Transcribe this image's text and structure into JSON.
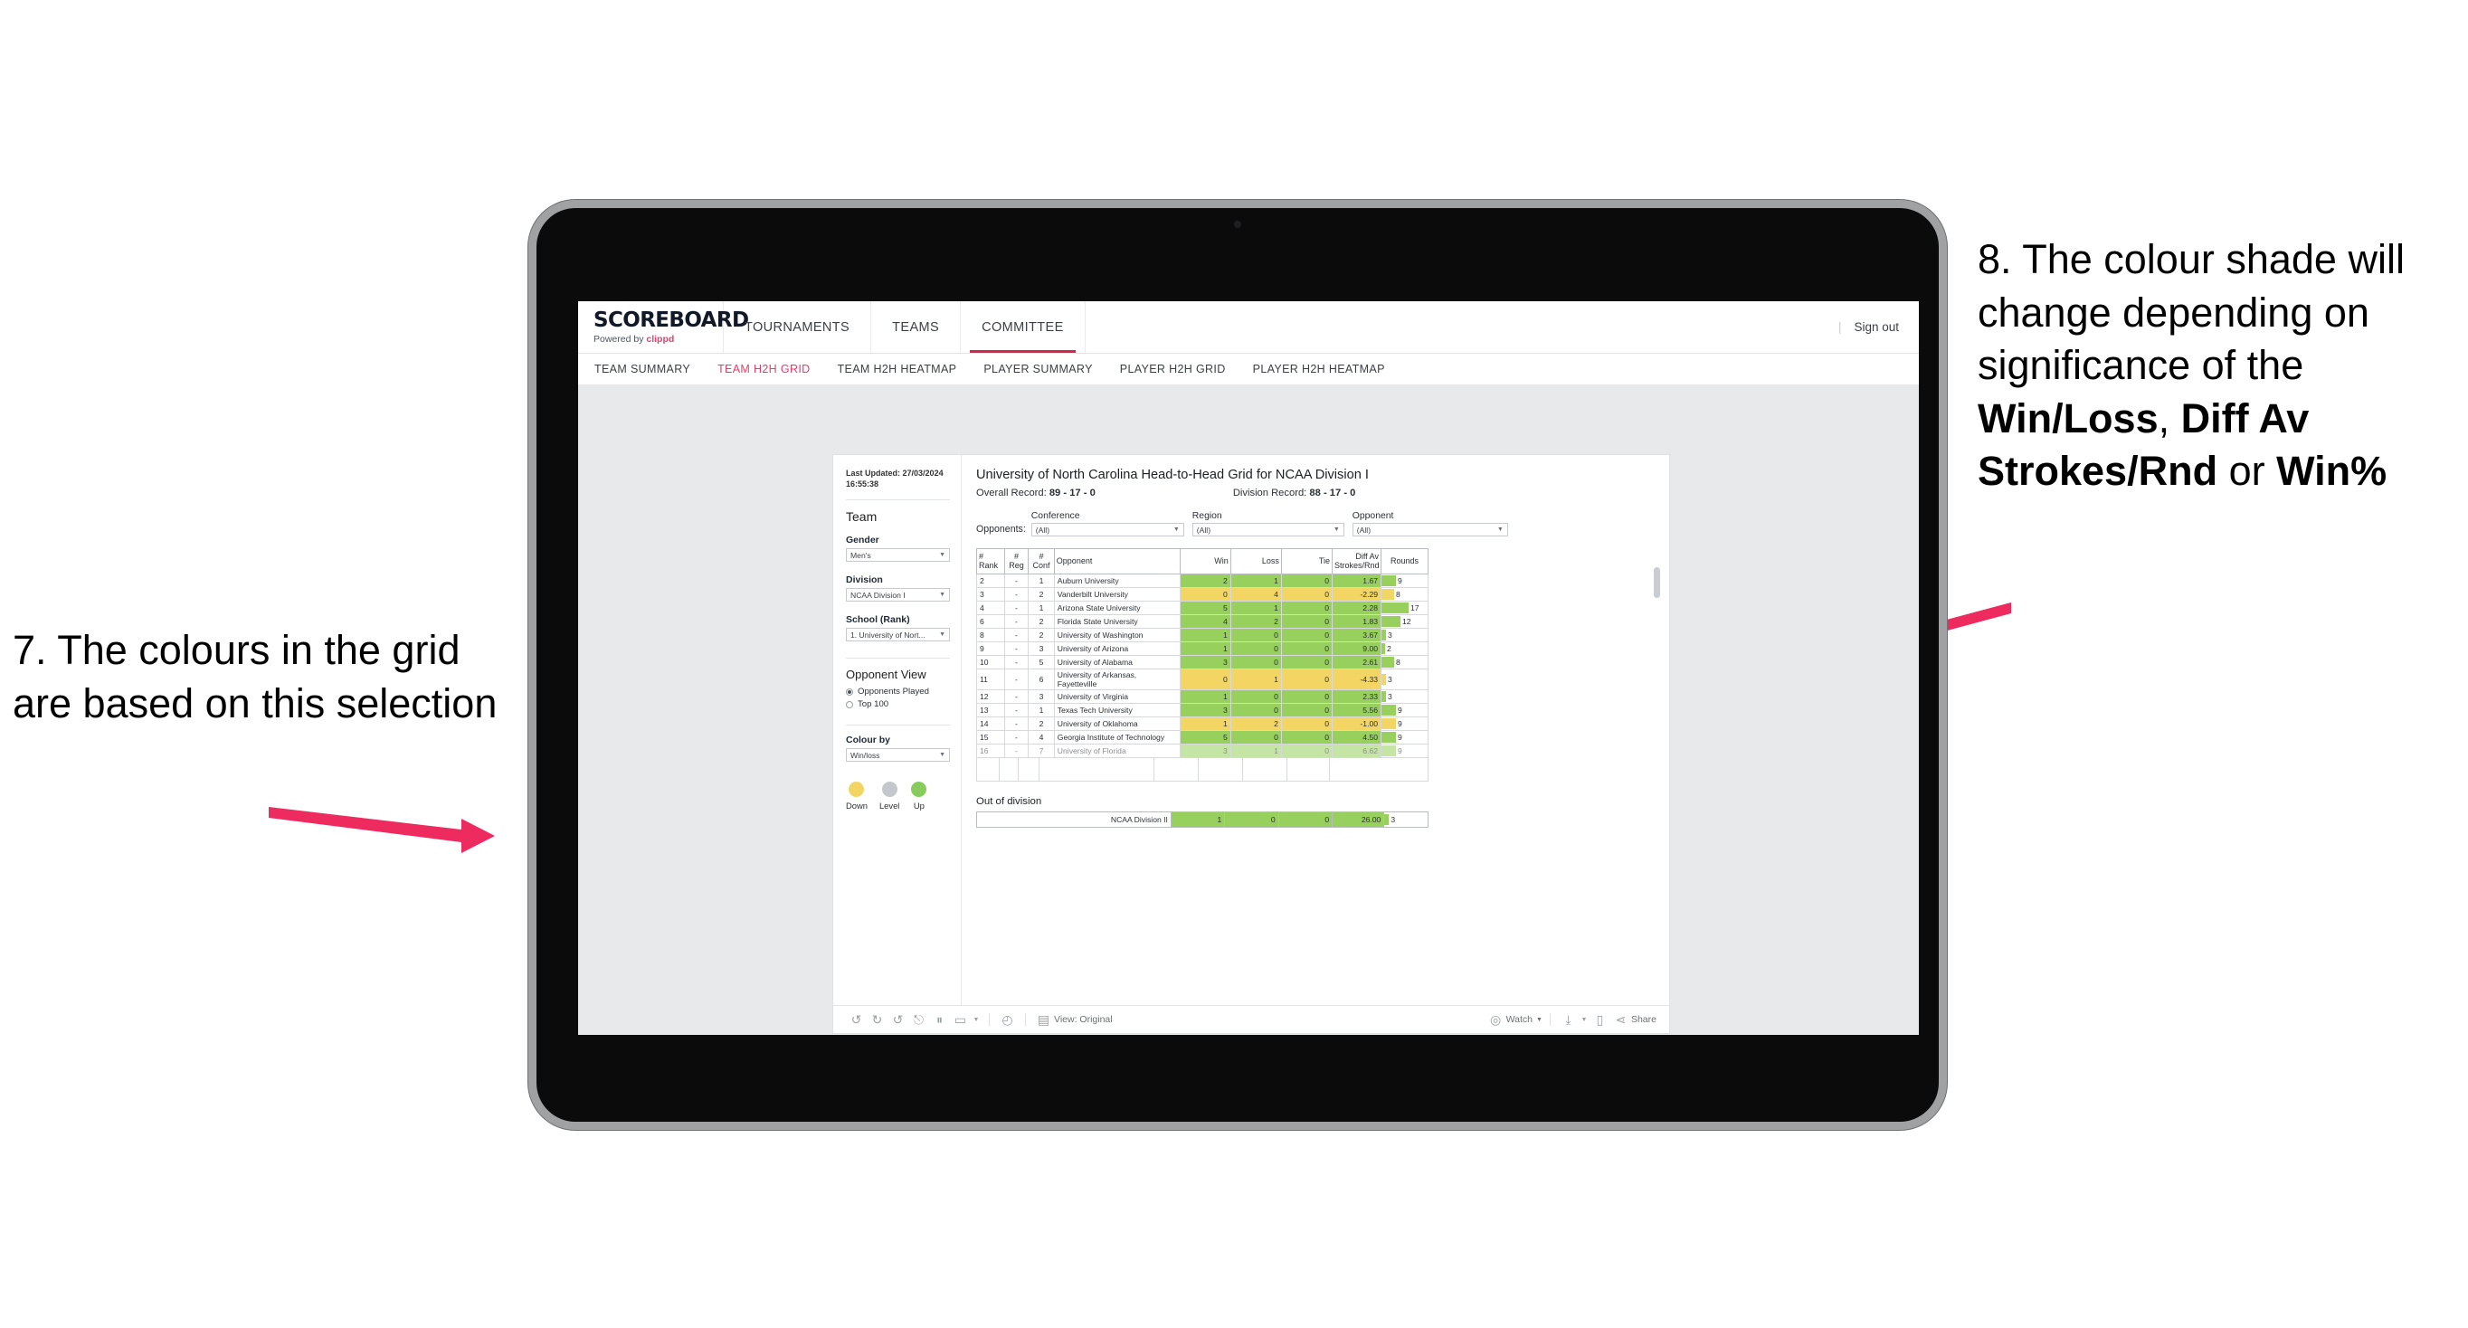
{
  "annotations": {
    "left": {
      "number": "7.",
      "text": "The colours in the grid are based on this selection"
    },
    "right": {
      "number": "8.",
      "line1": "The colour shade will change depending on significance of the ",
      "bold1": "Win/Loss",
      "mid1": ", ",
      "bold2": "Diff Av Strokes/Rnd",
      "mid2": " or ",
      "bold3": "Win%"
    },
    "arrow_color": "#ee2b5e"
  },
  "app": {
    "brand": {
      "title": "SCOREBOARD",
      "powered_prefix": "Powered by ",
      "powered_brand": "clippd"
    },
    "topnav": [
      {
        "label": "TOURNAMENTS",
        "active": false
      },
      {
        "label": "TEAMS",
        "active": false
      },
      {
        "label": "COMMITTEE",
        "active": true
      }
    ],
    "header_right": {
      "separator": "|",
      "sign_out": "Sign out"
    },
    "subnav": [
      {
        "label": "TEAM SUMMARY",
        "active": false
      },
      {
        "label": "TEAM H2H GRID",
        "active": true
      },
      {
        "label": "TEAM H2H HEATMAP",
        "active": false
      },
      {
        "label": "PLAYER SUMMARY",
        "active": false
      },
      {
        "label": "PLAYER H2H GRID",
        "active": false
      },
      {
        "label": "PLAYER H2H HEATMAP",
        "active": false
      }
    ],
    "accent_color": "#ee3a67"
  },
  "panel": {
    "last_updated_label": "Last Updated:",
    "last_updated_date": "27/03/2024",
    "last_updated_time": "16:55:38",
    "team_heading": "Team",
    "gender_label": "Gender",
    "gender_value": "Men's",
    "division_label": "Division",
    "division_value": "NCAA Division I",
    "school_label": "School (Rank)",
    "school_value": "1. University of Nort...",
    "opponent_view_heading": "Opponent View",
    "opponent_view_options": [
      {
        "label": "Opponents Played",
        "selected": true
      },
      {
        "label": "Top 100",
        "selected": false
      }
    ],
    "colour_by_label": "Colour by",
    "colour_by_value": "Win/loss",
    "legend": [
      {
        "label": "Down",
        "color": "#f3d564"
      },
      {
        "label": "Level",
        "color": "#c4c7cb"
      },
      {
        "label": "Up",
        "color": "#87cc5c"
      }
    ]
  },
  "main": {
    "title": "University of North Carolina Head-to-Head Grid for NCAA Division I",
    "overall_record_label": "Overall Record:",
    "overall_record_value": "89 - 17 - 0",
    "division_record_label": "Division Record:",
    "division_record_value": "88 - 17 - 0",
    "opponents_label": "Opponents:",
    "filters": [
      {
        "caption": "Conference",
        "value": "(All)"
      },
      {
        "caption": "Region",
        "value": "(All)"
      },
      {
        "caption": "Opponent",
        "value": "(All)"
      }
    ],
    "columns": [
      {
        "line1": "#",
        "line2": "Rank"
      },
      {
        "line1": "#",
        "line2": "Reg"
      },
      {
        "line1": "#",
        "line2": "Conf"
      },
      {
        "line1": "Opponent",
        "line2": ""
      },
      {
        "line1": "Win",
        "line2": ""
      },
      {
        "line1": "Loss",
        "line2": ""
      },
      {
        "line1": "Tie",
        "line2": ""
      },
      {
        "line1": "Diff Av",
        "line2": "Strokes/Rnd"
      },
      {
        "line1": "Rounds",
        "line2": ""
      }
    ],
    "out_of_division_heading": "Out of division"
  },
  "chart_data": {
    "type": "table",
    "title": "University of North Carolina Head-to-Head Grid for NCAA Division I",
    "colour_by": "Win/loss",
    "columns": [
      "# Rank",
      "# Reg",
      "# Conf",
      "Opponent",
      "Win",
      "Loss",
      "Tie",
      "Diff Av Strokes/Rnd",
      "Rounds"
    ],
    "rounds_max": 17,
    "colors": {
      "up": "#97d05d",
      "down": "#f3d564",
      "level": "#c4c7cb"
    },
    "rows": [
      {
        "rank": "2",
        "reg": "-",
        "conf": "1",
        "opponent": "Auburn University",
        "win": "2",
        "loss": "1",
        "tie": "0",
        "diff": "1.67",
        "rounds": 9,
        "state": "up"
      },
      {
        "rank": "3",
        "reg": "-",
        "conf": "2",
        "opponent": "Vanderbilt University",
        "win": "0",
        "loss": "4",
        "tie": "0",
        "diff": "-2.29",
        "rounds": 8,
        "state": "down"
      },
      {
        "rank": "4",
        "reg": "-",
        "conf": "1",
        "opponent": "Arizona State University",
        "win": "5",
        "loss": "1",
        "tie": "0",
        "diff": "2.28",
        "rounds": 17,
        "state": "up"
      },
      {
        "rank": "6",
        "reg": "-",
        "conf": "2",
        "opponent": "Florida State University",
        "win": "4",
        "loss": "2",
        "tie": "0",
        "diff": "1.83",
        "rounds": 12,
        "state": "up"
      },
      {
        "rank": "8",
        "reg": "-",
        "conf": "2",
        "opponent": "University of Washington",
        "win": "1",
        "loss": "0",
        "tie": "0",
        "diff": "3.67",
        "rounds": 3,
        "state": "up"
      },
      {
        "rank": "9",
        "reg": "-",
        "conf": "3",
        "opponent": "University of Arizona",
        "win": "1",
        "loss": "0",
        "tie": "0",
        "diff": "9.00",
        "rounds": 2,
        "state": "up"
      },
      {
        "rank": "10",
        "reg": "-",
        "conf": "5",
        "opponent": "University of Alabama",
        "win": "3",
        "loss": "0",
        "tie": "0",
        "diff": "2.61",
        "rounds": 8,
        "state": "up"
      },
      {
        "rank": "11",
        "reg": "-",
        "conf": "6",
        "opponent": "University of Arkansas, Fayetteville",
        "win": "0",
        "loss": "1",
        "tie": "0",
        "diff": "-4.33",
        "rounds": 3,
        "state": "down"
      },
      {
        "rank": "12",
        "reg": "-",
        "conf": "3",
        "opponent": "University of Virginia",
        "win": "1",
        "loss": "0",
        "tie": "0",
        "diff": "2.33",
        "rounds": 3,
        "state": "up"
      },
      {
        "rank": "13",
        "reg": "-",
        "conf": "1",
        "opponent": "Texas Tech University",
        "win": "3",
        "loss": "0",
        "tie": "0",
        "diff": "5.56",
        "rounds": 9,
        "state": "up"
      },
      {
        "rank": "14",
        "reg": "-",
        "conf": "2",
        "opponent": "University of Oklahoma",
        "win": "1",
        "loss": "2",
        "tie": "0",
        "diff": "-1.00",
        "rounds": 9,
        "state": "down"
      },
      {
        "rank": "15",
        "reg": "-",
        "conf": "4",
        "opponent": "Georgia Institute of Technology",
        "win": "5",
        "loss": "0",
        "tie": "0",
        "diff": "4.50",
        "rounds": 9,
        "state": "up"
      },
      {
        "rank": "16",
        "reg": "-",
        "conf": "7",
        "opponent": "University of Florida",
        "win": "3",
        "loss": "1",
        "tie": "0",
        "diff": "6.62",
        "rounds": 9,
        "state": "up"
      }
    ],
    "out_of_division": [
      {
        "opponent": "NCAA Division II",
        "win": "1",
        "loss": "0",
        "tie": "0",
        "diff": "26.00",
        "rounds": 3,
        "state": "up"
      }
    ]
  },
  "toolbar": {
    "undo": "undo-icon",
    "redo": "redo-icon",
    "revert": "revert-icon",
    "refresh": "refresh-icon",
    "pause": "pause-icon",
    "alerts": "alerts-icon",
    "view_label": "View: Original",
    "watch_label": "Watch",
    "share_label": "Share"
  }
}
